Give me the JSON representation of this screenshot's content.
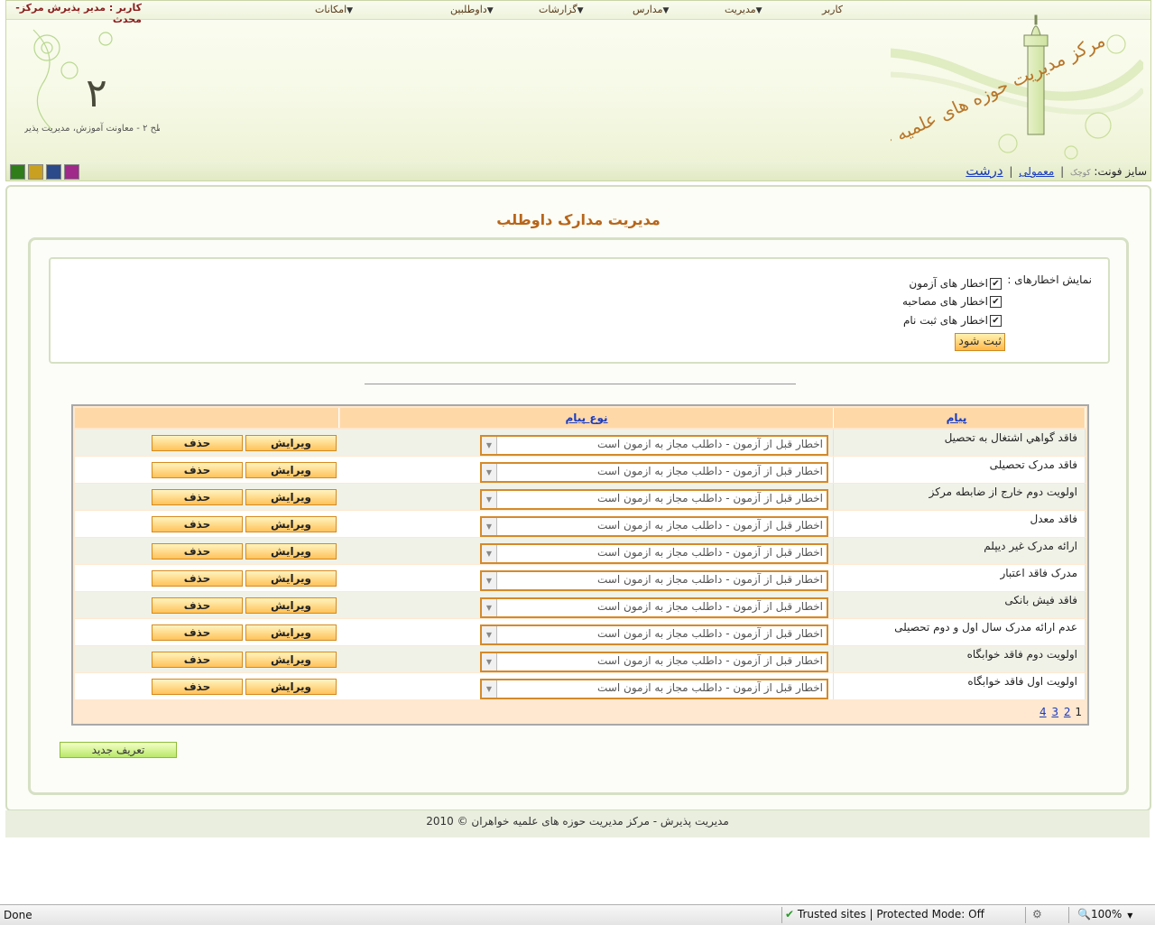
{
  "header": {
    "user_label": "کاربر : مدیر پذیرش مرکز-محدث",
    "menu": [
      {
        "label": "کاربر"
      },
      {
        "label": "مدیریت"
      },
      {
        "label": "مدارس"
      },
      {
        "label": "گزارشات"
      },
      {
        "label": "داوطلبین"
      },
      {
        "label": "امکانات"
      }
    ],
    "logo_text": "مرکز مدیریت حوزه های علمیه خواهران",
    "subtitle_text": "سطح ۲ - معاونت آموزش، مدیریت پذیرش",
    "font_size_label": "سایز فونت:",
    "font_small": "کوچک",
    "font_normal": "معمولی",
    "font_large": "درشت",
    "swatch_colors": [
      "#2e7d1a",
      "#c9a020",
      "#2a4a8a",
      "#a02a8a"
    ]
  },
  "page": {
    "title": "مدیریت مدارک داوطلب",
    "filter_label": "نمایش اخطارهای :",
    "checkboxes": [
      {
        "label": "اخطار های آزمون",
        "checked": true
      },
      {
        "label": "اخطار های مصاحبه",
        "checked": true
      },
      {
        "label": "اخطار های ثبت نام",
        "checked": true
      }
    ],
    "submit_label": "ثبت شود"
  },
  "grid": {
    "columns": {
      "name": "پیام",
      "type": "نوع پیام",
      "actions": ""
    },
    "rows": [
      {
        "name": "فاقد گواهي اشتغال به تحصيل",
        "type": "اخطار قبل از آزمون - داطلب مجاز به ازمون است"
      },
      {
        "name": "فاقد مدرک تحصیلی",
        "type": "اخطار قبل از آزمون - داطلب مجاز به ازمون است"
      },
      {
        "name": "اولویت دوم خارج از ضابطه مرکز",
        "type": "اخطار قبل از آزمون - داطلب مجاز به ازمون است"
      },
      {
        "name": "فاقد معدل",
        "type": "اخطار قبل از آزمون - داطلب مجاز به ازمون است"
      },
      {
        "name": "ارائه مدرک غیر دیپلم",
        "type": "اخطار قبل از آزمون - داطلب مجاز به ازمون است"
      },
      {
        "name": "مدرک فاقد اعتبار",
        "type": "اخطار قبل از آزمون - داطلب مجاز به ازمون است"
      },
      {
        "name": "فاقد فیش بانکی",
        "type": "اخطار قبل از آزمون - داطلب مجاز به ازمون است"
      },
      {
        "name": "عدم ارائه مدرک سال اول و دوم تحصیلی",
        "type": "اخطار قبل از آزمون - داطلب مجاز به ازمون است"
      },
      {
        "name": "اولویت دوم فاقد خوابگاه",
        "type": "اخطار قبل از آزمون - داطلب مجاز به ازمون است"
      },
      {
        "name": "اولویت اول فاقد خوابگاه",
        "type": "اخطار قبل از آزمون - داطلب مجاز به ازمون است"
      }
    ],
    "edit_label": "ویرایش",
    "delete_label": "حذف",
    "pager": {
      "current": "1",
      "pages": [
        "2",
        "3",
        "4"
      ]
    }
  },
  "new_button_label": "تعریف جدید",
  "footer_text": "مدیریت پذیرش - مرکز مدیریت حوزه های علمیه خواهران © 2010",
  "statusbar": {
    "status": "Done",
    "zone": "Trusted sites | Protected Mode: Off",
    "zoom": "100%"
  }
}
